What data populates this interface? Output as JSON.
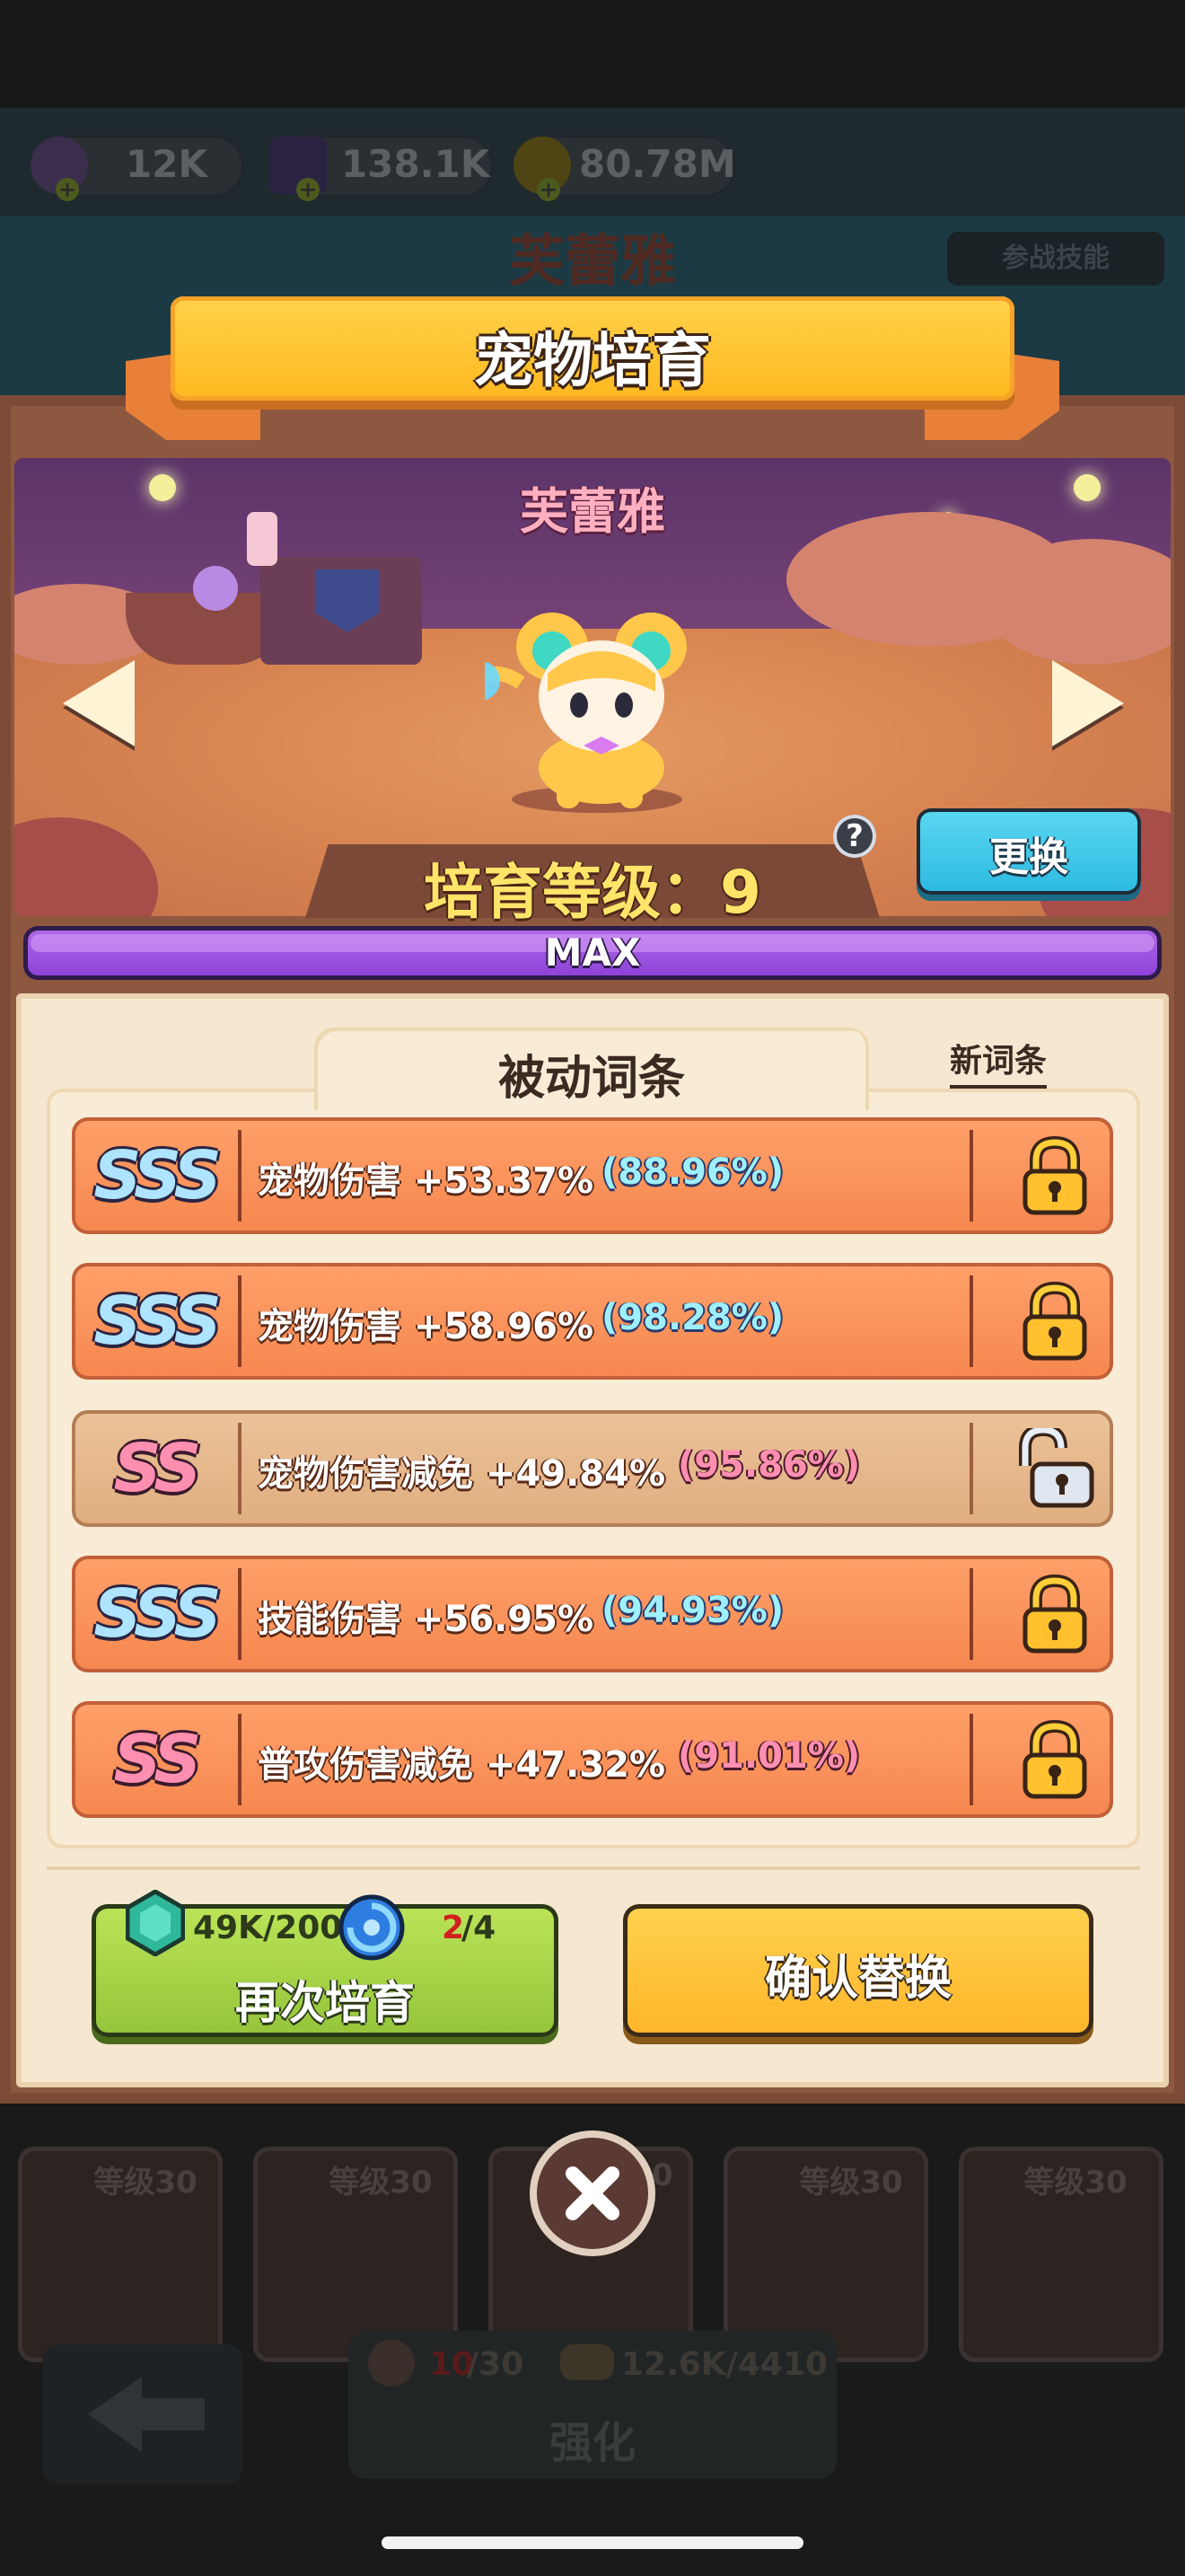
{
  "background": {
    "currencies": [
      {
        "icon": "purple-gem-icon",
        "value": "12K"
      },
      {
        "icon": "dark-cube-icon",
        "value": "138.1K"
      },
      {
        "icon": "gold-coin-icon",
        "value": "80.78M"
      }
    ],
    "pet_name": "芙蕾雅",
    "battle_skill_label": "参战技能",
    "pet_cards": [
      {
        "level": "等级30"
      },
      {
        "level": "等级30"
      },
      {
        "level": "0"
      },
      {
        "level": "等级30"
      },
      {
        "level": "等级30"
      }
    ],
    "enhance": {
      "cost1_used": "10",
      "cost1_total": "/30",
      "cost2": "12.6K/4410",
      "label": "强化"
    }
  },
  "modal": {
    "title": "宠物培育",
    "pet_name": "芙蕾雅",
    "level_label": "培育等级：9",
    "help_symbol": "?",
    "swap_label": "更换",
    "progress": {
      "label": "MAX",
      "fraction": 1.0
    }
  },
  "passives": {
    "tab_label": "被动词条",
    "new_link": "新词条",
    "rows": [
      {
        "grade": "SSS",
        "stat": "宠物伤害 +53.37%",
        "pct": "(88.96%)",
        "locked": true
      },
      {
        "grade": "SSS",
        "stat": "宠物伤害 +58.96%",
        "pct": "(98.28%)",
        "locked": true
      },
      {
        "grade": "SS",
        "stat": "宠物伤害减免 +49.84%",
        "pct": "(95.86%)",
        "locked": false
      },
      {
        "grade": "SSS",
        "stat": "技能伤害 +56.95%",
        "pct": "(94.93%)",
        "locked": true
      },
      {
        "grade": "SS",
        "stat": "普攻伤害减免 +47.32%",
        "pct": "(91.01%)",
        "locked": true
      }
    ]
  },
  "actions": {
    "retrain": {
      "label": "再次培育",
      "cost1": "49K/200",
      "cost2_have": "2",
      "cost2_need": "/4"
    },
    "confirm_label": "确认替换"
  },
  "colors": {
    "banner": "#ffc838",
    "sss_grade": "#aee4ff",
    "ss_grade": "#ff8fb0",
    "max_bar": "#9b52e0",
    "retrain": "#a8d448",
    "confirm": "#ffc03c",
    "swap": "#3fc8ea"
  }
}
